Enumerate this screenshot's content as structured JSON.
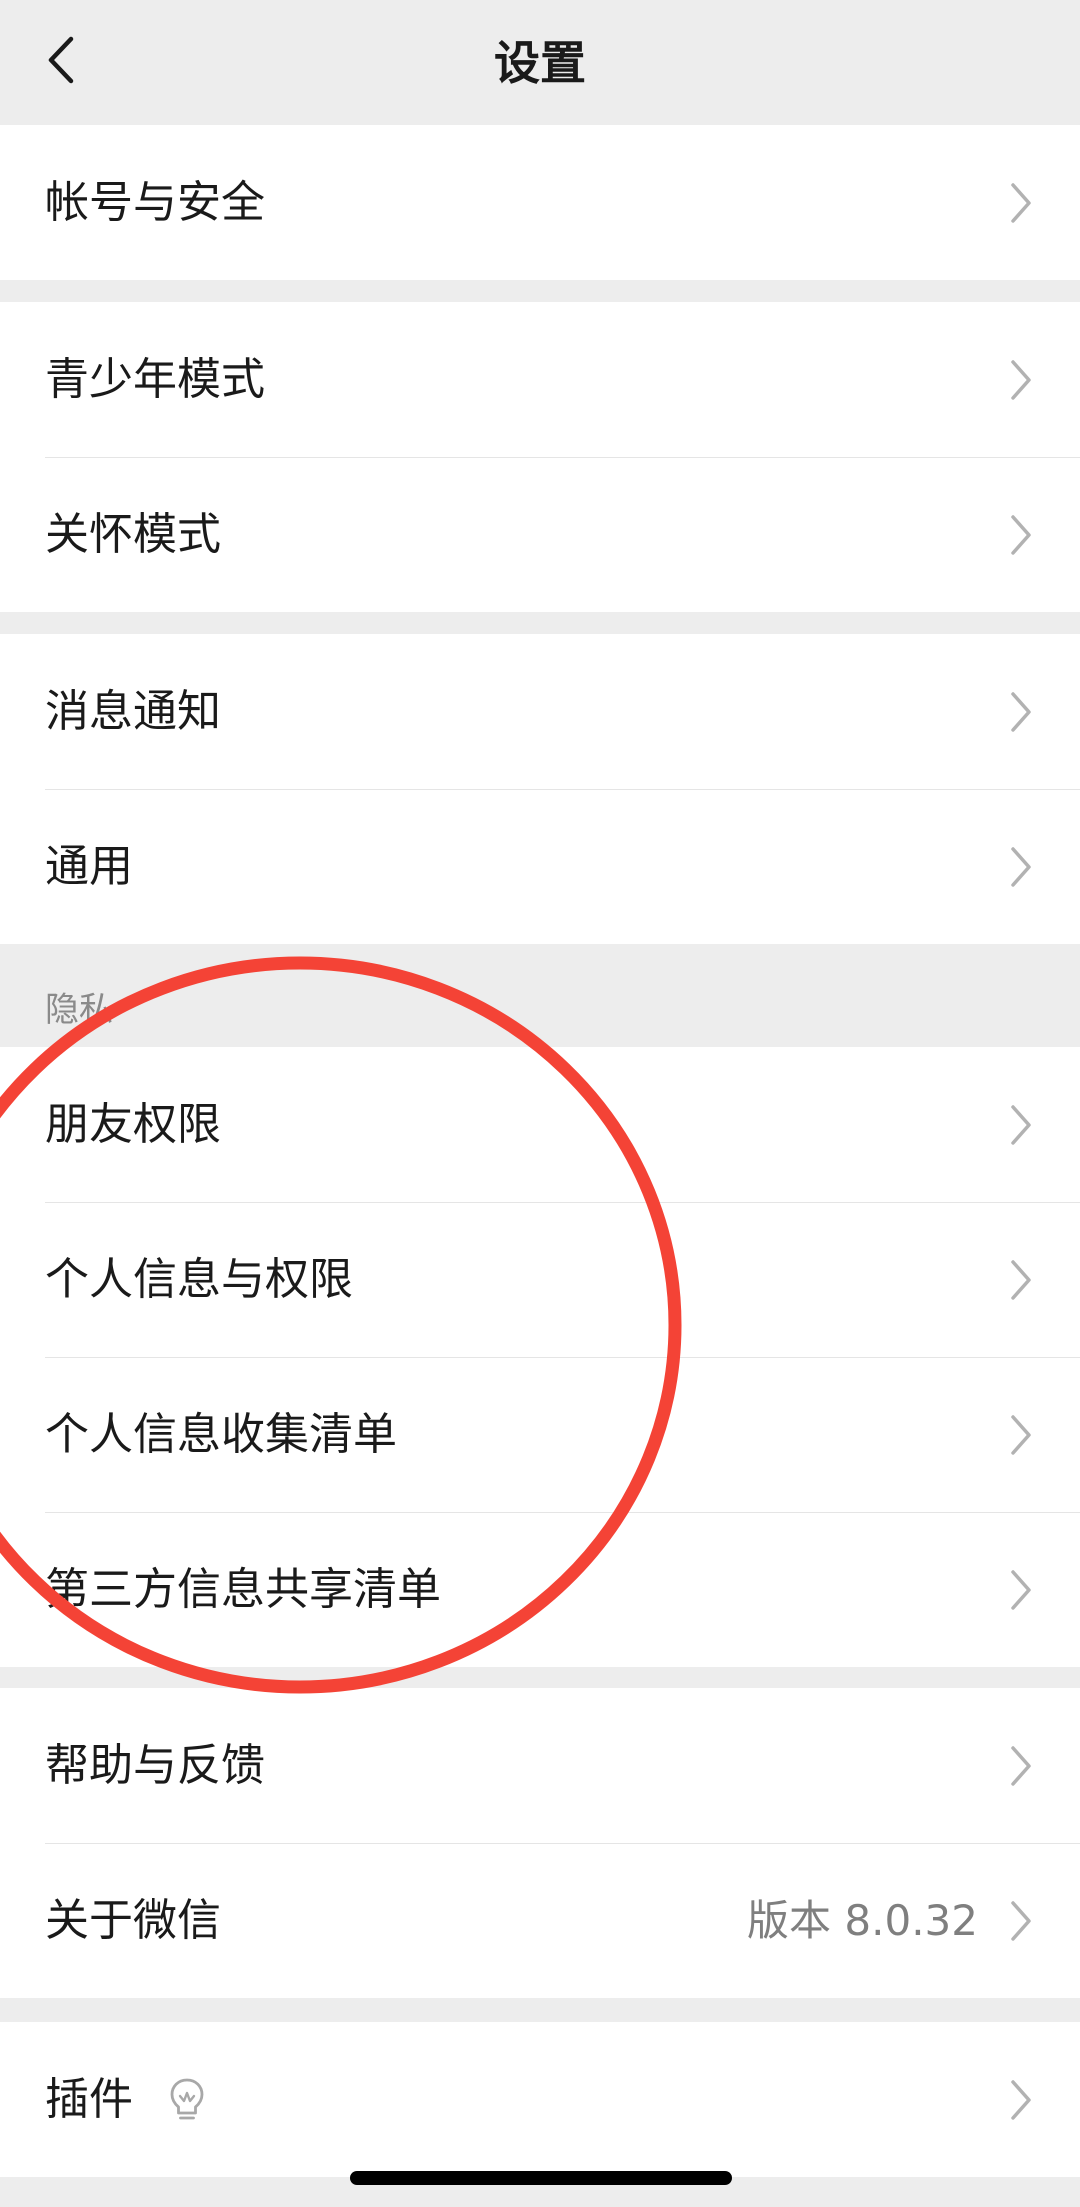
{
  "header": {
    "title": "设置",
    "back_icon": "chevron-left-icon"
  },
  "groups": [
    {
      "rows": [
        {
          "label": "帐号与安全"
        }
      ]
    },
    {
      "rows": [
        {
          "label": "青少年模式"
        },
        {
          "label": "关怀模式"
        }
      ]
    },
    {
      "rows": [
        {
          "label": "消息通知"
        },
        {
          "label": "通用"
        }
      ]
    },
    {
      "section_label": "隐私",
      "rows": [
        {
          "label": "朋友权限"
        },
        {
          "label": "个人信息与权限"
        },
        {
          "label": "个人信息收集清单"
        },
        {
          "label": "第三方信息共享清单"
        }
      ]
    },
    {
      "rows": [
        {
          "label": "帮助与反馈"
        },
        {
          "label": "关于微信",
          "value": "版本 8.0.32"
        }
      ]
    },
    {
      "rows": [
        {
          "label": "插件",
          "icon": "lightbulb-icon"
        }
      ]
    }
  ],
  "colors": {
    "background": "#ededed",
    "annotation_circle": "#f44336"
  }
}
